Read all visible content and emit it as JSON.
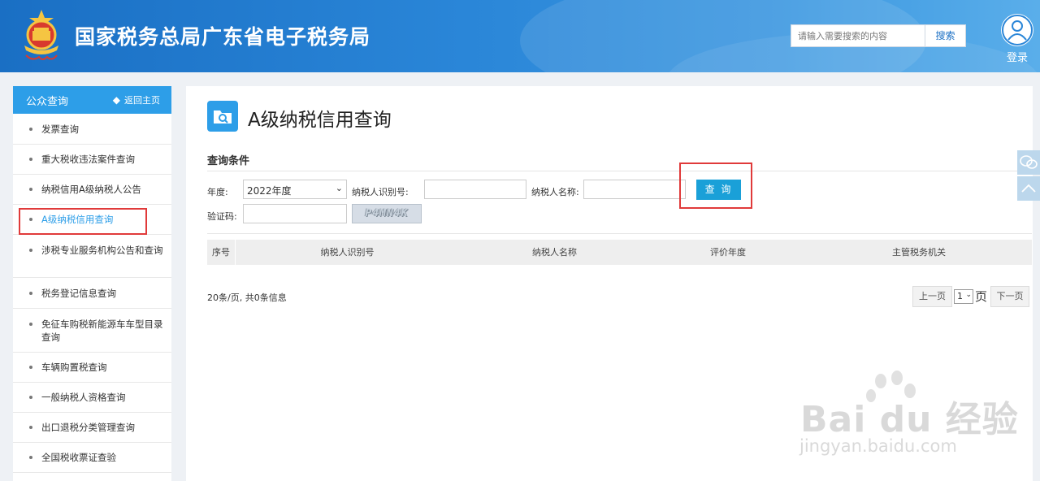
{
  "header": {
    "emblem_icon": "national-tax-emblem-icon",
    "title": "国家税务总局广东省电子税务局",
    "search_placeholder": "请输入需要搜索的内容",
    "search_button": "搜索",
    "login_icon": "user-avatar-icon",
    "login_label": "登录"
  },
  "sidebar": {
    "title": "公众查询",
    "back_label": "返回主页",
    "items": [
      {
        "label": "发票查询"
      },
      {
        "label": "重大税收违法案件查询"
      },
      {
        "label": "纳税信用A级纳税人公告"
      },
      {
        "label": "A级纳税信用查询",
        "active": true
      },
      {
        "label": "涉税专业服务机构公告和查询"
      },
      {
        "label": "税务登记信息查询"
      },
      {
        "label": "免征车购税新能源车车型目录查询"
      },
      {
        "label": "车辆购置税查询"
      },
      {
        "label": "一般纳税人资格查询"
      },
      {
        "label": "出口退税分类管理查询"
      },
      {
        "label": "全国税收票证查验"
      }
    ]
  },
  "main": {
    "page_icon": "search-folder-icon",
    "title": "A级纳税信用查询",
    "section_title": "查询条件",
    "filters": {
      "year_label": "年度:",
      "year_value": "2022年度",
      "taxpayer_id_label": "纳税人识别号:",
      "taxpayer_id_value": "",
      "taxpayer_name_label": "纳税人名称:",
      "taxpayer_name_value": "",
      "query_button": "查 询",
      "captcha_label": "验证码:",
      "captcha_value": "",
      "captcha_image_text": "P4MN4K"
    },
    "table": {
      "columns": [
        "序号",
        "纳税人识别号",
        "纳税人名称",
        "评价年度",
        "主管税务机关"
      ],
      "rows": []
    },
    "pagination": {
      "info": "20条/页, 共0条信息",
      "prev_label": "上一页",
      "page_value": "1",
      "page_unit": "页",
      "next_label": "下一页"
    }
  },
  "float_tools": [
    "chat-bubble-icon",
    "chevron-up-icon"
  ],
  "watermark": {
    "logo_text": "Bai du 经验",
    "url": "jingyan.baidu.com"
  },
  "colors": {
    "header_blue": "#1a6fc4",
    "accent_blue": "#2d9ee8",
    "query_button": "#1aa0d8",
    "highlight_red": "#e03a3a"
  }
}
